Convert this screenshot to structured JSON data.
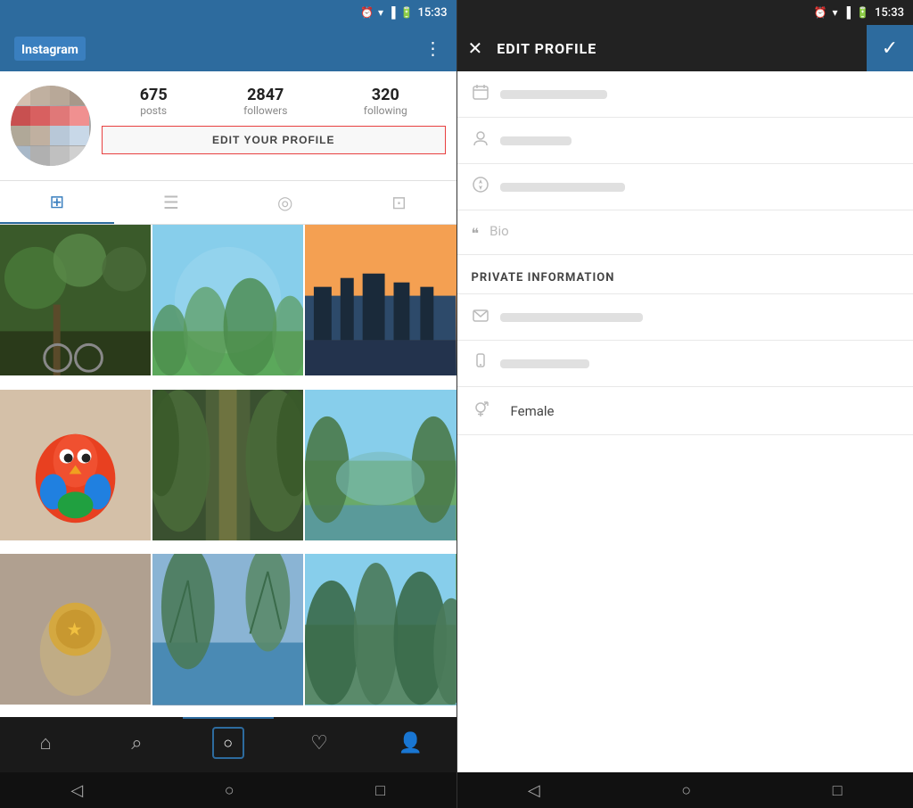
{
  "left": {
    "status_bar": {
      "time": "15:33"
    },
    "top_nav": {
      "app_name": "Instagram",
      "more_icon": "⋮"
    },
    "profile": {
      "stats": [
        {
          "number": "675",
          "label": "posts"
        },
        {
          "number": "2847",
          "label": "followers"
        },
        {
          "number": "320",
          "label": "following"
        }
      ],
      "edit_button": "EDIT YOUR PROFILE"
    },
    "tabs": [
      {
        "icon": "⊞",
        "active": true
      },
      {
        "icon": "☰",
        "active": false
      },
      {
        "icon": "◎",
        "active": false
      },
      {
        "icon": "⊡",
        "active": false
      }
    ],
    "bottom_nav": [
      {
        "icon": "⌂",
        "label": "home",
        "active": false
      },
      {
        "icon": "⌕",
        "label": "search",
        "active": false
      },
      {
        "icon": "○",
        "label": "camera",
        "active": true
      },
      {
        "icon": "♡",
        "label": "activity",
        "active": false
      },
      {
        "icon": "👤",
        "label": "profile",
        "active": false
      }
    ],
    "android_nav": {
      "back": "◁",
      "home": "○",
      "recent": "□"
    }
  },
  "right": {
    "status_bar": {
      "time": "15:33"
    },
    "header": {
      "close_icon": "✕",
      "title": "EDIT PROFILE",
      "check_icon": "✓"
    },
    "form": {
      "fields": [
        {
          "icon": "📅",
          "type": "bar",
          "width": "w120"
        },
        {
          "icon": "👤",
          "type": "bar",
          "width": "w80"
        },
        {
          "icon": "🧭",
          "type": "bar",
          "width": "w140"
        }
      ],
      "bio": {
        "icon": "❝",
        "placeholder": "Bio"
      },
      "private_section": "PRIVATE INFORMATION",
      "private_fields": [
        {
          "icon": "✉",
          "type": "bar",
          "width": "w160"
        },
        {
          "icon": "📱",
          "type": "bar",
          "width": "w100"
        }
      ],
      "gender": {
        "icon": "⚥",
        "value": "Female"
      }
    },
    "android_nav": {
      "back": "◁",
      "home": "○",
      "recent": "□"
    }
  }
}
